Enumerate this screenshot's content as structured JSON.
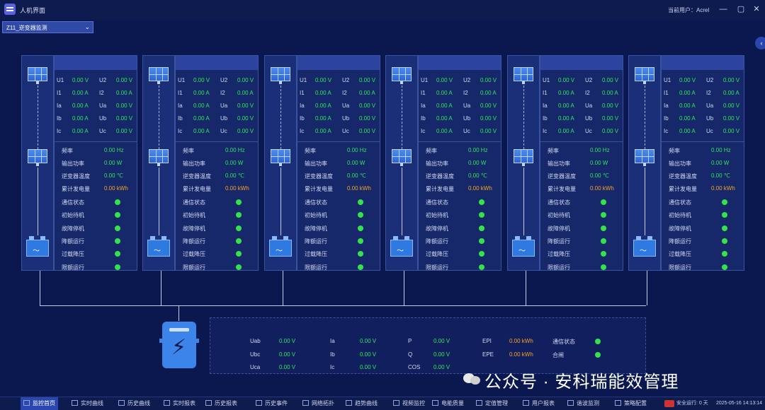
{
  "window": {
    "title": "人机界面",
    "user_label": "当前用户：Acrel",
    "minimize": "—",
    "maximize": "▢",
    "close": "✕"
  },
  "selector": {
    "value": "Z11_逆变器监测",
    "arrow": "⌄"
  },
  "collapse_glyph": "‹",
  "inverters": [
    {
      "phase_rows": [
        {
          "a_label": "U1",
          "a_value": "0.00 V",
          "b_label": "U2",
          "b_value": "0.00 V"
        },
        {
          "a_label": "I1",
          "a_value": "0.00 A",
          "b_label": "I2",
          "b_value": "0.00 A"
        },
        {
          "a_label": "Ia",
          "a_value": "0.00 A",
          "b_label": "Ua",
          "b_value": "0.00 V"
        },
        {
          "a_label": "Ib",
          "a_value": "0.00 A",
          "b_label": "Ub",
          "b_value": "0.00 V"
        },
        {
          "a_label": "Ic",
          "a_value": "0.00 A",
          "b_label": "Uc",
          "b_value": "0.00 V"
        }
      ],
      "metrics": [
        {
          "label": "频率",
          "value": "0.00 Hz",
          "color": "#2ee65a"
        },
        {
          "label": "输出功率",
          "value": "0.00 W",
          "color": "#2ee65a"
        },
        {
          "label": "逆变器温度",
          "value": "0.00 ℃",
          "color": "#2ee65a"
        },
        {
          "label": "累计发电量",
          "value": "0.00 kWh",
          "color": "#f7a320"
        }
      ],
      "statuses": [
        "通信状态",
        "初始待机",
        "故障停机",
        "降额运行",
        "过载降压",
        "限额运行"
      ]
    },
    {
      "phase_rows": [
        {
          "a_label": "U1",
          "a_value": "0.00 V",
          "b_label": "U2",
          "b_value": "0.00 V"
        },
        {
          "a_label": "I1",
          "a_value": "0.00 A",
          "b_label": "I2",
          "b_value": "0.00 A"
        },
        {
          "a_label": "Ia",
          "a_value": "0.00 A",
          "b_label": "Ua",
          "b_value": "0.00 V"
        },
        {
          "a_label": "Ib",
          "a_value": "0.00 A",
          "b_label": "Ub",
          "b_value": "0.00 V"
        },
        {
          "a_label": "Ic",
          "a_value": "0.00 A",
          "b_label": "Uc",
          "b_value": "0.00 V"
        }
      ],
      "metrics": [
        {
          "label": "频率",
          "value": "0.00 Hz",
          "color": "#2ee65a"
        },
        {
          "label": "输出功率",
          "value": "0.00 W",
          "color": "#2ee65a"
        },
        {
          "label": "逆变器温度",
          "value": "0.00 ℃",
          "color": "#2ee65a"
        },
        {
          "label": "累计发电量",
          "value": "0.00 kWh",
          "color": "#f7a320"
        }
      ],
      "statuses": [
        "通信状态",
        "初始待机",
        "故障停机",
        "降额运行",
        "过载降压",
        "限额运行"
      ]
    },
    {
      "phase_rows": [
        {
          "a_label": "U1",
          "a_value": "0.00 V",
          "b_label": "U2",
          "b_value": "0.00 V"
        },
        {
          "a_label": "I1",
          "a_value": "0.00 A",
          "b_label": "I2",
          "b_value": "0.00 A"
        },
        {
          "a_label": "Ia",
          "a_value": "0.00 A",
          "b_label": "Ua",
          "b_value": "0.00 V"
        },
        {
          "a_label": "Ib",
          "a_value": "0.00 A",
          "b_label": "Ub",
          "b_value": "0.00 V"
        },
        {
          "a_label": "Ic",
          "a_value": "0.00 A",
          "b_label": "Uc",
          "b_value": "0.00 V"
        }
      ],
      "metrics": [
        {
          "label": "频率",
          "value": "0.00 Hz",
          "color": "#2ee65a"
        },
        {
          "label": "输出功率",
          "value": "0.00 W",
          "color": "#2ee65a"
        },
        {
          "label": "逆变器温度",
          "value": "0.00 ℃",
          "color": "#2ee65a"
        },
        {
          "label": "累计发电量",
          "value": "0.00 kWh",
          "color": "#f7a320"
        }
      ],
      "statuses": [
        "通信状态",
        "初始待机",
        "故障停机",
        "降额运行",
        "过载降压",
        "限额运行"
      ]
    },
    {
      "phase_rows": [
        {
          "a_label": "U1",
          "a_value": "0.00 V",
          "b_label": "U2",
          "b_value": "0.00 V"
        },
        {
          "a_label": "I1",
          "a_value": "0.00 A",
          "b_label": "I2",
          "b_value": "0.00 A"
        },
        {
          "a_label": "Ia",
          "a_value": "0.00 A",
          "b_label": "Ua",
          "b_value": "0.00 V"
        },
        {
          "a_label": "Ib",
          "a_value": "0.00 A",
          "b_label": "Ub",
          "b_value": "0.00 V"
        },
        {
          "a_label": "Ic",
          "a_value": "0.00 A",
          "b_label": "Uc",
          "b_value": "0.00 V"
        }
      ],
      "metrics": [
        {
          "label": "频率",
          "value": "0.00 Hz",
          "color": "#2ee65a"
        },
        {
          "label": "输出功率",
          "value": "0.00 W",
          "color": "#2ee65a"
        },
        {
          "label": "逆变器温度",
          "value": "0.00 ℃",
          "color": "#2ee65a"
        },
        {
          "label": "累计发电量",
          "value": "0.00 kWh",
          "color": "#f7a320"
        }
      ],
      "statuses": [
        "通信状态",
        "初始待机",
        "故障停机",
        "降额运行",
        "过载降压",
        "限额运行"
      ]
    },
    {
      "phase_rows": [
        {
          "a_label": "U1",
          "a_value": "0.00 V",
          "b_label": "U2",
          "b_value": "0.00 V"
        },
        {
          "a_label": "I1",
          "a_value": "0.00 A",
          "b_label": "I2",
          "b_value": "0.00 A"
        },
        {
          "a_label": "Ia",
          "a_value": "0.00 A",
          "b_label": "Ua",
          "b_value": "0.00 V"
        },
        {
          "a_label": "Ib",
          "a_value": "0.00 A",
          "b_label": "Ub",
          "b_value": "0.00 V"
        },
        {
          "a_label": "Ic",
          "a_value": "0.00 A",
          "b_label": "Uc",
          "b_value": "0.00 V"
        }
      ],
      "metrics": [
        {
          "label": "频率",
          "value": "0.00 Hz",
          "color": "#2ee65a"
        },
        {
          "label": "输出功率",
          "value": "0.00 W",
          "color": "#2ee65a"
        },
        {
          "label": "逆变器温度",
          "value": "0.00 ℃",
          "color": "#2ee65a"
        },
        {
          "label": "累计发电量",
          "value": "0.00 kWh",
          "color": "#f7a320"
        }
      ],
      "statuses": [
        "通信状态",
        "初始待机",
        "故障停机",
        "降额运行",
        "过载降压",
        "限额运行"
      ]
    },
    {
      "phase_rows": [
        {
          "a_label": "U1",
          "a_value": "0.00 V",
          "b_label": "U2",
          "b_value": "0.00 V"
        },
        {
          "a_label": "I1",
          "a_value": "0.00 A",
          "b_label": "I2",
          "b_value": "0.00 A"
        },
        {
          "a_label": "Ia",
          "a_value": "0.00 A",
          "b_label": "Ua",
          "b_value": "0.00 V"
        },
        {
          "a_label": "Ib",
          "a_value": "0.00 A",
          "b_label": "Ub",
          "b_value": "0.00 V"
        },
        {
          "a_label": "Ic",
          "a_value": "0.00 A",
          "b_label": "Uc",
          "b_value": "0.00 V"
        }
      ],
      "metrics": [
        {
          "label": "频率",
          "value": "0.00 Hz",
          "color": "#2ee65a"
        },
        {
          "label": "输出功率",
          "value": "0.00 W",
          "color": "#2ee65a"
        },
        {
          "label": "逆变器温度",
          "value": "0.00 ℃",
          "color": "#2ee65a"
        },
        {
          "label": "累计发电量",
          "value": "0.00 kWh",
          "color": "#f7a320"
        }
      ],
      "statuses": [
        "通信状态",
        "初始待机",
        "故障停机",
        "降额运行",
        "过载降压",
        "限额运行"
      ]
    }
  ],
  "meter": {
    "col1": [
      {
        "label": "Uab",
        "value": "0.00 V"
      },
      {
        "label": "Ubc",
        "value": "0.00 V"
      },
      {
        "label": "Uca",
        "value": "0.00 V"
      }
    ],
    "col2": [
      {
        "label": "Ia",
        "value": "0.00 V"
      },
      {
        "label": "Ib",
        "value": "0.00 V"
      },
      {
        "label": "Ic",
        "value": "0.00 V"
      }
    ],
    "col3": [
      {
        "label": "P",
        "value": "0.00 V"
      },
      {
        "label": "Q",
        "value": "0.00 V"
      },
      {
        "label": "COS",
        "value": "0.00 V"
      }
    ],
    "col4": [
      {
        "label": "EPI",
        "value": "0.00 kWh"
      },
      {
        "label": "EPE",
        "value": "0.00 kWh"
      }
    ],
    "statuses": [
      "通信状态",
      "合闸"
    ]
  },
  "watermark": "公众号 · 安科瑞能效管理",
  "nav": [
    "监控首页",
    "实时曲线",
    "历史曲线",
    "实时报表",
    "历史报表",
    "历史事件",
    "网络拓扑",
    "趋势曲线",
    "视频监控",
    "电能质量",
    "定值管理",
    "用户报表",
    "谐波监测",
    "策略配置"
  ],
  "status": {
    "running": "安全运行: 0 天",
    "datetime": "2025-05-16 14:13:14"
  },
  "colors": {
    "value_green": "#2ee65a",
    "value_orange": "#f7a320",
    "dot_green": "#34e24a",
    "bg": "#0b1850"
  }
}
